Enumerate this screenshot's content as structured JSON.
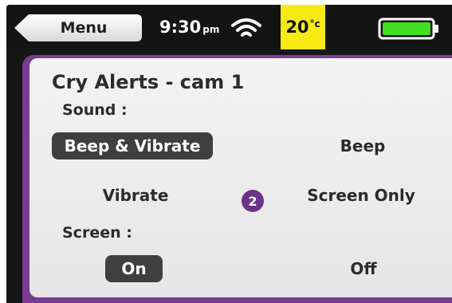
{
  "statusbar": {
    "menu_label": "Menu",
    "time": "9:30",
    "ampm": "pm",
    "temperature": "20",
    "temperature_unit": "°c",
    "temp_highlight_color": "#f7ea13",
    "battery_level": 1.0,
    "battery_color": "#3fe01d",
    "wifi_icon": "wifi-icon",
    "battery_icon": "battery-icon"
  },
  "panel": {
    "title": "Cry Alerts - cam 1",
    "accent_color": "#7a3c93",
    "step_badge": "2",
    "sound": {
      "label": "Sound :",
      "options": [
        "Beep & Vibrate",
        "Beep",
        "Vibrate",
        "Screen Only"
      ],
      "selected": "Beep & Vibrate"
    },
    "screen": {
      "label": "Screen :",
      "options": [
        "On",
        "Off"
      ],
      "selected": "On"
    }
  }
}
